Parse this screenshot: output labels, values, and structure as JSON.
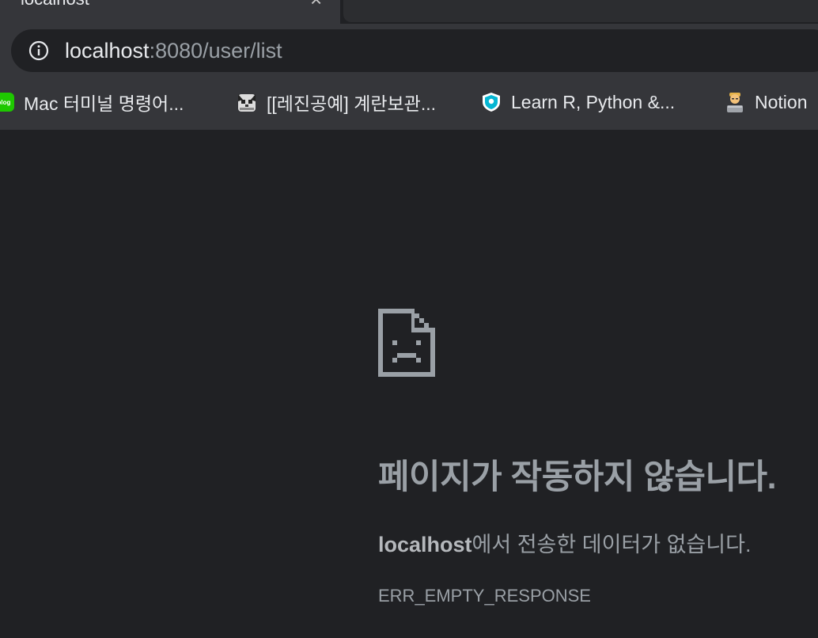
{
  "tab": {
    "title": "localhost",
    "close_glyph": "×"
  },
  "omnibox": {
    "host": "localhost",
    "path": ":8080/user/list",
    "icon": "info-icon"
  },
  "bookmarks": [
    {
      "label": "Mac 터미널 명령어...",
      "icon": "blog-icon",
      "icon_text": "blog"
    },
    {
      "label": "[[레진공예] 계란보관...",
      "icon": "cat-face-icon"
    },
    {
      "label": "Learn R, Python &...",
      "icon": "datacamp-shield-icon"
    },
    {
      "label": "Notion",
      "icon": "person-laptop-icon"
    }
  ],
  "error": {
    "icon": "sad-page-icon",
    "heading": "페이지가 작동하지 않습니다.",
    "host": "localhost",
    "message": "에서 전송한 데이터가 없습니다.",
    "code": "ERR_EMPTY_RESPONSE"
  },
  "colors": {
    "background": "#202124",
    "toolbar": "#35363a",
    "text_primary": "#e8eaed",
    "text_muted": "#9aa0a6"
  }
}
